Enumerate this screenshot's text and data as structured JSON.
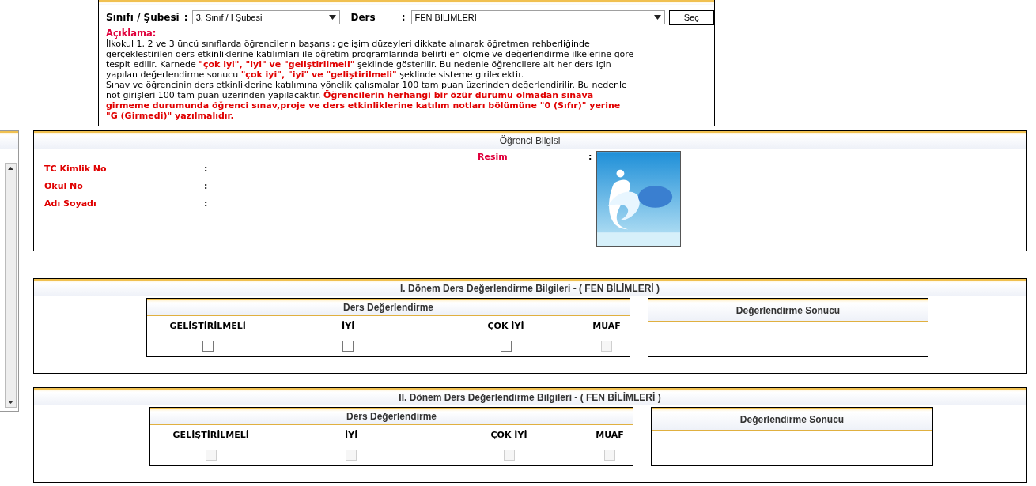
{
  "top_form": {
    "class_label": "Sınıfı / Şubesi",
    "class_separator": ":",
    "class_select": {
      "value": "3. Sınıf / I Şubesi"
    },
    "course_label": "Ders",
    "course_separator": ":",
    "course_select": {
      "value": "FEN BİLİMLERİ"
    },
    "select_button": "Seç"
  },
  "description": {
    "title": "Açıklama:",
    "paragraphs": [
      "İlkokul 1, 2 ve 3 üncü sınıflarda öğrencilerin başarısı; gelişim düzeyleri dikkate alınarak öğretmen rehberliğinde gerçekleştirilen ders etkinliklerine katılımları ile öğretim programlarında belirtilen ölçme ve değerlendirme ilkelerine göre tespit edilir. Karnede **\"çok iyi\", \"iyi\" ve \"geliştirilmeli\"** şeklinde gösterilir. Bu nedenle öğrencilere ait her ders için yapılan değerlendirme sonucu **\"çok iyi\", \"iyi\" ve \"geliştirilmeli\"** şeklinde sisteme girilecektir.",
      "Sınav ve öğrencinin ders etkinliklerine katılımına yönelik çalışmalar 100 tam puan üzerinden değerlendirilir. Bu nedenle not girişleri 100 tam puan üzerinden yapılacaktır. **Öğrencilerin herhangi bir özür durumu olmadan sınava girmeme durumunda öğrenci sınav,proje ve ders etkinliklerine katılım notları bölümüne \"0 (Sıfır)\" yerine \"G (Girmedi)\" yazılmalıdır.**"
    ]
  },
  "student": {
    "title": "Öğrenci Bilgisi",
    "photo": {
      "label": "Resim",
      "separator": ":",
      "kind": "picture"
    },
    "fields": [
      {
        "label": "TC Kimlik No",
        "separator": ":"
      },
      {
        "label": "Okul No",
        "separator": ":"
      },
      {
        "label": "Adı Soyadı",
        "separator": ":"
      }
    ]
  },
  "semesters": [
    {
      "title": "I. Dönem Ders Değerlendirme Bilgileri - ( FEN BİLİMLERİ )",
      "grading": {
        "title": "Ders Değerlendirme",
        "options": [
          {
            "label": "GELİŞTİRİLMELİ",
            "checked": false,
            "disabled": false
          },
          {
            "label": "İYİ",
            "checked": false,
            "disabled": false
          },
          {
            "label": "ÇOK İYİ",
            "checked": false,
            "disabled": false
          },
          {
            "label": "MUAF",
            "checked": false,
            "disabled": true
          }
        ]
      },
      "result": {
        "title": "Değerlendirme Sonucu"
      }
    },
    {
      "title": "II. Dönem Ders Değerlendirme Bilgileri - ( FEN BİLİMLERİ )",
      "grading": {
        "title": "Ders Değerlendirme",
        "options": [
          {
            "label": "GELİŞTİRİLMELİ",
            "checked": false,
            "disabled": true
          },
          {
            "label": "İYİ",
            "checked": false,
            "disabled": true
          },
          {
            "label": "ÇOK İYİ",
            "checked": false,
            "disabled": true
          },
          {
            "label": "MUAF",
            "checked": false,
            "disabled": true
          }
        ]
      },
      "result": {
        "title": "Değerlendirme Sonucu"
      }
    }
  ]
}
